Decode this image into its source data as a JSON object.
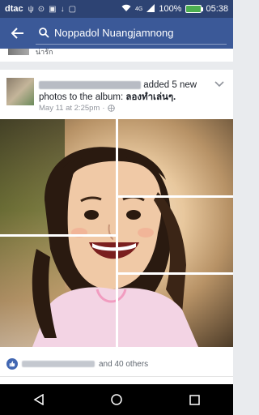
{
  "status_bar": {
    "carrier": "dtac",
    "network": "4G",
    "battery": "100%",
    "time": "05:38"
  },
  "app_bar": {
    "search_query": "Noppadol Nuangjamnong"
  },
  "previous_post": {
    "text": "น่ารัก"
  },
  "post": {
    "action_text": "added 5 new photos to the album:",
    "album_name": "ลองทำเล่นๆ.",
    "date": "May 11 at 2:25pm",
    "separator": "·",
    "likes_text": "and 40 others"
  },
  "colors": {
    "brand": "#3b5998",
    "status_bar": "#2d4373",
    "like_blue": "#4267b2"
  }
}
